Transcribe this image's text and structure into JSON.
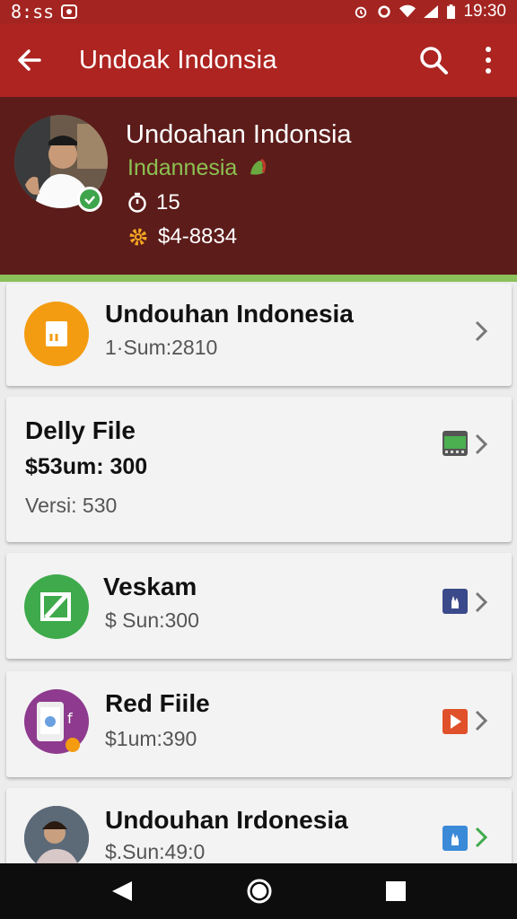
{
  "status_bar": {
    "left_text": "8:ss",
    "time": "19:30",
    "icons": [
      "android-notification-icon",
      "alarm-icon",
      "settings-icon",
      "wifi-icon",
      "signal-icon",
      "battery-icon"
    ]
  },
  "app_bar": {
    "title": "Undoak Indonsia",
    "back_icon": "arrow-left-icon",
    "search_icon": "search-icon",
    "more_icon": "more-vert-icon"
  },
  "profile": {
    "name": "Undoahan Indonsia",
    "country": "Indannesia",
    "stat1_value": "15",
    "stat2_value": "$4-8834",
    "colors": {
      "header": "#5c1c1a",
      "accent_green": "#8bc05a"
    }
  },
  "cards": [
    {
      "title": "Undouhan Indonesia",
      "sub1": "1·Sum:2810",
      "icon": "orange-app-icon"
    },
    {
      "title": "Delly File",
      "sub1": "$53um: 300",
      "sub2": "Versi: 530",
      "icon": "film-icon"
    },
    {
      "title": "Veskam",
      "sub1": "$ Sun:300",
      "icon": "green-edit-icon"
    },
    {
      "title": "Red Fiile",
      "sub1": "$1um:390",
      "icon": "purple-app-icon"
    },
    {
      "title": "Undouhan Irdonesia",
      "sub1": "$.Sun:49:0",
      "icon": "user-avatar-icon"
    }
  ],
  "nav_bar": {
    "back": "nav-back-icon",
    "home": "nav-home-icon",
    "recents": "nav-recents-icon"
  }
}
